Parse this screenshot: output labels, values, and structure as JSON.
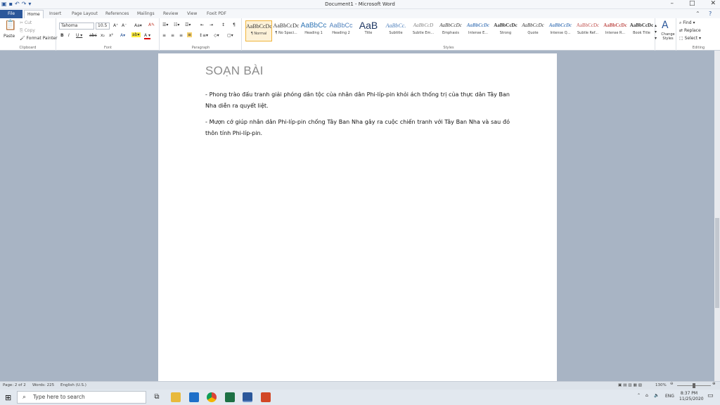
{
  "window": {
    "title": "Document1 - Microsoft Word"
  },
  "tabs": [
    "File",
    "Home",
    "Insert",
    "Page Layout",
    "References",
    "Mailings",
    "Review",
    "View",
    "Foxit PDF"
  ],
  "clipboard": {
    "paste": "Paste",
    "cut": "Cut",
    "copy": "Copy",
    "format_painter": "Format Painter",
    "label": "Clipboard"
  },
  "font": {
    "name": "Tahoma",
    "size": "10.5",
    "label": "Font"
  },
  "paragraph": {
    "label": "Paragraph"
  },
  "styles": {
    "label": "Styles",
    "items": [
      {
        "preview": "AaBbCcDc",
        "name": "¶ Normal"
      },
      {
        "preview": "AaBbCcDc",
        "name": "¶ No Spaci..."
      },
      {
        "preview": "AaBbCc",
        "name": "Heading 1"
      },
      {
        "preview": "AaBbCc",
        "name": "Heading 2"
      },
      {
        "preview": "AaB",
        "name": "Title"
      },
      {
        "preview": "AaBbCc.",
        "name": "Subtitle"
      },
      {
        "preview": "AaBbCcD",
        "name": "Subtle Em..."
      },
      {
        "preview": "AaBbCcDc",
        "name": "Emphasis"
      },
      {
        "preview": "AaBbCcDc",
        "name": "Intense E..."
      },
      {
        "preview": "AaBbCcDc",
        "name": "Strong"
      },
      {
        "preview": "AaBbCcDc",
        "name": "Quote"
      },
      {
        "preview": "AaBbCcDc",
        "name": "Intense Q..."
      },
      {
        "preview": "AaBbCcDc",
        "name": "Subtle Ref..."
      },
      {
        "preview": "AaBbCcDc",
        "name": "Intense R..."
      },
      {
        "preview": "AaBbCcDc",
        "name": "Book Title"
      }
    ]
  },
  "change_styles": "Change Styles",
  "editing": {
    "find": "Find",
    "replace": "Replace",
    "select": "Select",
    "label": "Editing"
  },
  "document": {
    "heading": "SOẠN BÀI",
    "paragraphs": [
      "- Phong trào đấu tranh giải phóng dân tộc của nhân dân Phi-líp-pin khỏi ách thống trị của thực dân Tây Ban Nha diễn ra quyết liệt.",
      "- Mượn cớ giúp nhân dân Phi-líp-pin chống Tây Ban Nha gây ra cuộc chiến tranh với Tây Ban Nha và sau đó thôn tính Phi-líp-pin."
    ]
  },
  "status": {
    "page": "Page: 2 of 2",
    "words": "Words: 225",
    "language": "English (U.S.)",
    "zoom": "130%"
  },
  "taskbar": {
    "search_placeholder": "Type here to search",
    "lang": "ENG",
    "time": "8:37 PM",
    "date": "11/25/2020"
  },
  "colors": {
    "accent": "#2b579a",
    "workspace": "#a8b4c4"
  }
}
